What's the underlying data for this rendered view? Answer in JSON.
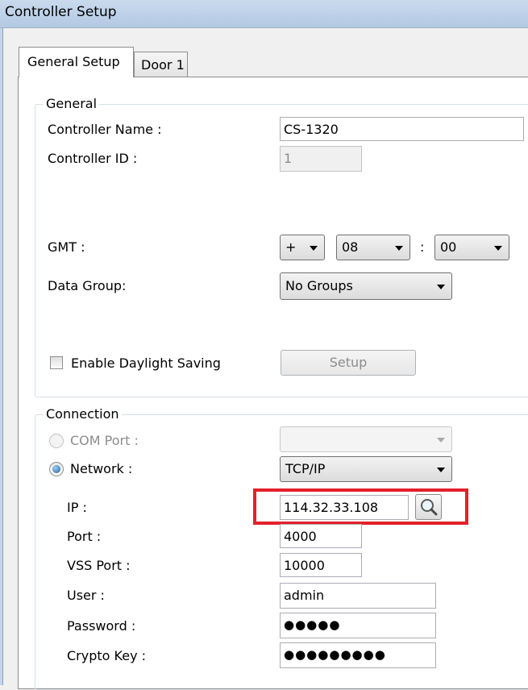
{
  "window": {
    "title": "Controller Setup"
  },
  "tabs": [
    {
      "label": "General Setup",
      "active": true
    },
    {
      "label": "Door 1",
      "active": false
    }
  ],
  "general": {
    "legend": "General",
    "controller_name_label": "Controller Name :",
    "controller_name_value": "CS-1320",
    "controller_id_label": "Controller ID :",
    "controller_id_value": "1",
    "gmt_label": "GMT :",
    "gmt_sign": "+",
    "gmt_hours": "08",
    "gmt_separator": ":",
    "gmt_minutes": "00",
    "data_group_label": "Data Group:",
    "data_group_value": "No Groups",
    "daylight_saving_label": "Enable Daylight Saving",
    "daylight_saving_checked": false,
    "setup_button_label": "Setup"
  },
  "connection": {
    "legend": "Connection",
    "com_port_label": "COM Port :",
    "com_port_value": "",
    "network_label": "Network :",
    "network_value": "TCP/IP",
    "ip_label": "IP :",
    "ip_value": "114.32.33.108",
    "port_label": "Port :",
    "port_value": "4000",
    "vss_port_label": "VSS Port :",
    "vss_port_value": "10000",
    "user_label": "User :",
    "user_value": "admin",
    "password_label": "Password :",
    "password_value": "●●●●●",
    "crypto_key_label": "Crypto Key :",
    "crypto_key_value": "●●●●●●●●●"
  },
  "icons": {
    "lookup": "magnifier-icon"
  },
  "colors": {
    "highlight": "#e4202a",
    "titlebar": "#bcd1e8"
  }
}
